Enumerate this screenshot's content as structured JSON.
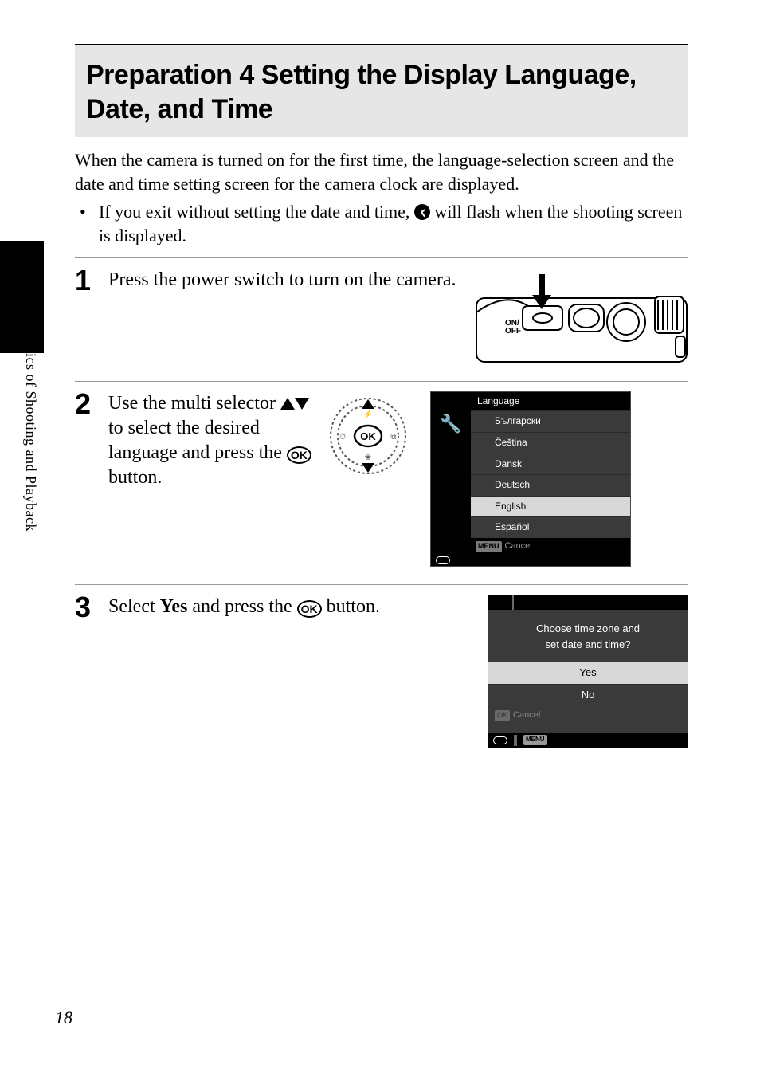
{
  "page_number": "18",
  "side_label": "The Basics of Shooting and Playback",
  "title": "Preparation 4 Setting the Display Language, Date, and Time",
  "intro": "When the camera is turned on for the first time, the language-selection screen and the date and time setting screen for the camera clock are displayed.",
  "bullet_pre": "If you exit without setting the date and time, ",
  "bullet_post": " will flash when the shooting screen is displayed.",
  "steps": {
    "s1": {
      "num": "1",
      "text": "Press the power switch to turn on the camera."
    },
    "s2": {
      "num": "2",
      "text_pre": "Use the multi selector ",
      "text_mid": " to select the desired language and press the ",
      "text_post": " button."
    },
    "s3": {
      "num": "3",
      "text_pre": "Select ",
      "text_bold": "Yes",
      "text_mid": " and press the ",
      "text_post": " button."
    }
  },
  "camera_label": "ON/\nOFF",
  "ok_label": "OK",
  "lang_menu": {
    "title": "Language",
    "items": [
      "Български",
      "Čeština",
      "Dansk",
      "Deutsch",
      "English",
      "Español"
    ],
    "selected_index": 4,
    "cancel_label": "Cancel",
    "menu_badge": "MENU"
  },
  "yn_menu": {
    "message_l1": "Choose time zone and",
    "message_l2": "set date and time?",
    "yes": "Yes",
    "no": "No",
    "cancel_label": "Cancel",
    "menu_badge": "MENU"
  }
}
